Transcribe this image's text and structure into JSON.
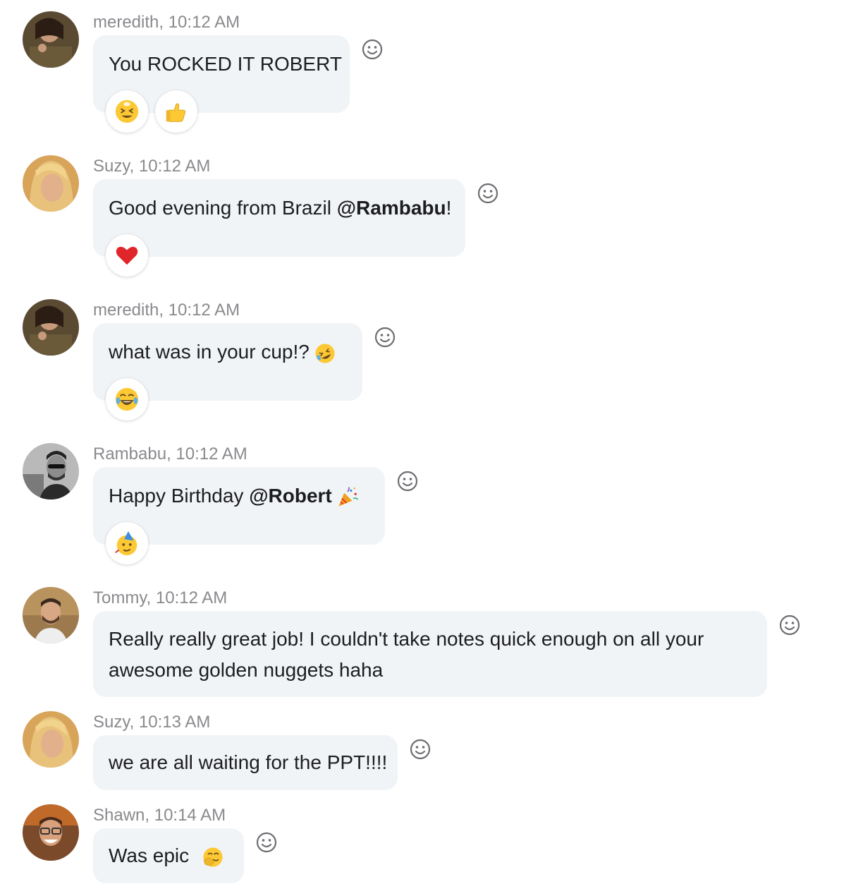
{
  "messages": [
    {
      "author": "meredith",
      "time": "10:12 AM",
      "meta": "meredith, 10:12 AM",
      "text": "You ROCKED IT ROBERT",
      "reactions": [
        "smiling-squint-face-emoji",
        "thumbs-up-emoji"
      ]
    },
    {
      "author": "Suzy",
      "time": "10:12 AM",
      "meta": "Suzy, 10:12 AM",
      "text_before": "Good evening from Brazil ",
      "mention": "@Rambabu",
      "text_after": "!",
      "reactions": [
        "red-heart-emoji"
      ]
    },
    {
      "author": "meredith",
      "time": "10:12 AM",
      "meta": "meredith, 10:12 AM",
      "text": "what was in your cup!?",
      "inline_emoji": "rolling-on-floor-laughing-emoji",
      "reactions": [
        "tears-of-joy-face-emoji"
      ]
    },
    {
      "author": "Rambabu",
      "time": "10:12 AM",
      "meta": "Rambabu, 10:12 AM",
      "text_before": "Happy Birthday ",
      "mention": "@Robert",
      "inline_emoji": "party-popper-emoji",
      "reactions": [
        "partying-face-emoji"
      ]
    },
    {
      "author": "Tommy",
      "time": "10:12 AM",
      "meta": "Tommy, 10:12 AM",
      "line1": "Really really great job!  I couldn't take notes quick enough on all your",
      "line2": "awesome golden nuggets haha"
    },
    {
      "author": "Suzy",
      "time": "10:13 AM",
      "meta": "Suzy, 10:13 AM",
      "text": "we are all waiting for the PPT!!!!"
    },
    {
      "author": "Shawn",
      "time": "10:14 AM",
      "meta": "Shawn, 10:14 AM",
      "text": "Was epic",
      "inline_emoji": "face-with-hand-over-mouth-emoji"
    }
  ],
  "icons": {
    "add_reaction": "smiley-outline-icon"
  },
  "colors": {
    "bubble": "#f1f4f7",
    "meta_text": "#8a8a8e",
    "body_text": "#1d1d1f"
  }
}
